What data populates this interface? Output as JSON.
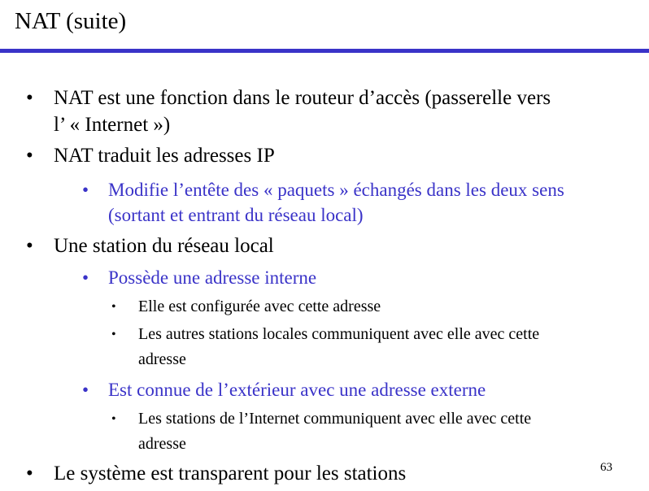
{
  "slide": {
    "title": "NAT (suite)",
    "page_number": "63",
    "bullet_l1": "•",
    "bullet_l2": "•",
    "bullet_l3": "•",
    "items": [
      {
        "level": 1,
        "lines": [
          "NAT est une fonction dans le routeur d’accès (passerelle vers",
          "l’ « Internet »)"
        ]
      },
      {
        "level": 1,
        "lines": [
          "NAT traduit les adresses IP"
        ]
      },
      {
        "level": 2,
        "lines": [
          "Modifie l’entête des « paquets » échangés dans les deux sens",
          "(sortant et entrant du réseau local)"
        ]
      },
      {
        "level": 1,
        "lines": [
          "Une station du réseau local"
        ]
      },
      {
        "level": 2,
        "lines": [
          "Possède une adresse interne"
        ]
      },
      {
        "level": 3,
        "lines": [
          "Elle est configurée avec cette adresse"
        ]
      },
      {
        "level": 3,
        "lines": [
          "Les autres stations locales communiquent avec elle avec cette",
          "adresse"
        ]
      },
      {
        "level": 2,
        "lines": [
          "Est connue de l’extérieur avec une adresse externe"
        ]
      },
      {
        "level": 3,
        "lines": [
          "Les stations de l’Internet communiquent avec elle avec cette",
          "adresse"
        ]
      },
      {
        "level": 1,
        "lines": [
          "Le système est transparent pour les stations"
        ]
      }
    ]
  }
}
